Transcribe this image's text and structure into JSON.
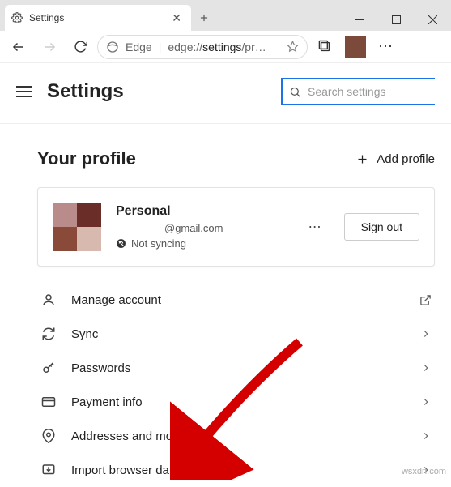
{
  "window": {
    "tab_title": "Settings",
    "minimize": "—",
    "maximize": "▢",
    "close": "✕"
  },
  "toolbar": {
    "edge_label": "Edge",
    "url_prefix": "edge://",
    "url_bold": "settings",
    "url_suffix": "/pr…"
  },
  "header": {
    "title": "Settings",
    "search_placeholder": "Search settings"
  },
  "profile_section": {
    "heading": "Your profile",
    "add_profile": "Add profile"
  },
  "profile_card": {
    "name": "Personal",
    "email": "@gmail.com",
    "sync_status": "Not syncing",
    "signout": "Sign out"
  },
  "menu": {
    "items": [
      {
        "label": "Manage account",
        "icon": "person",
        "action": "external"
      },
      {
        "label": "Sync",
        "icon": "sync",
        "action": "chevron"
      },
      {
        "label": "Passwords",
        "icon": "key",
        "action": "chevron"
      },
      {
        "label": "Payment info",
        "icon": "card",
        "action": "chevron"
      },
      {
        "label": "Addresses and more",
        "icon": "pin",
        "action": "chevron"
      },
      {
        "label": "Import browser data",
        "icon": "import",
        "action": "chevron"
      }
    ]
  },
  "watermark": "wsxdn.com"
}
